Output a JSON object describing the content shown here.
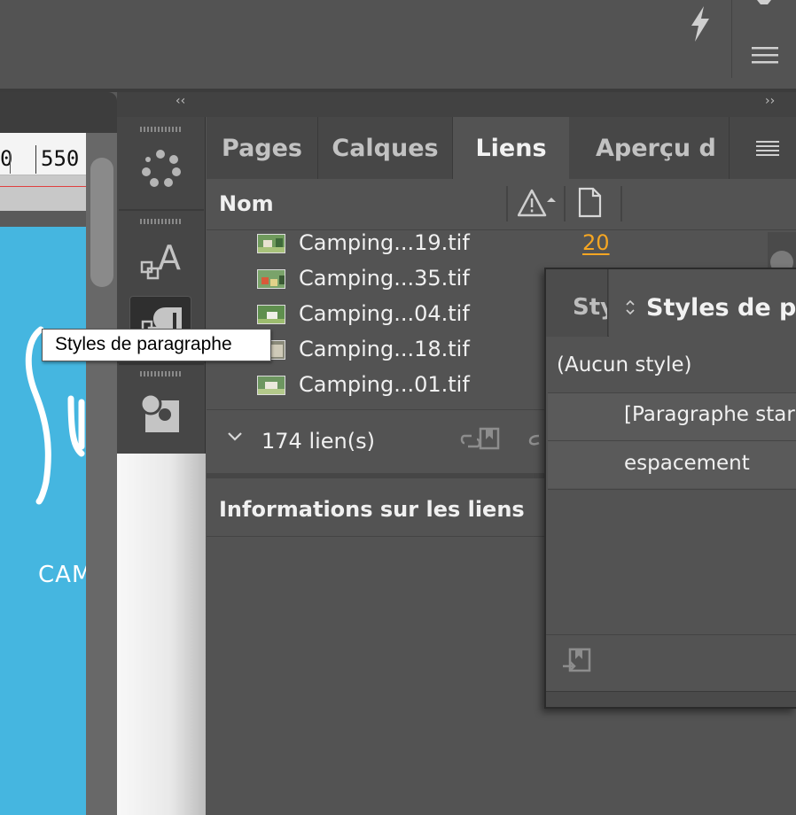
{
  "toolbar": {
    "lightning_icon": "lightning-icon",
    "menu_icon": "hamburger-menu-icon"
  },
  "document": {
    "ruler_left_label": "0",
    "ruler_label": "550",
    "page_text": "CAM"
  },
  "dock": {
    "collapse_left": "‹‹",
    "collapse_right": "››",
    "icons": [
      "color-swatches-icon",
      "character-styles-icon",
      "paragraph-styles-icon",
      "object-styles-icon"
    ]
  },
  "tooltip": {
    "text": "Styles de paragraphe"
  },
  "links_panel": {
    "tabs": [
      {
        "label": "Pages",
        "active": false
      },
      {
        "label": "Calques",
        "active": false
      },
      {
        "label": "Liens",
        "active": true
      },
      {
        "label": "Aperçu d",
        "active": false
      }
    ],
    "column_name": "Nom",
    "links": [
      {
        "name": "Camping...19.tif",
        "page": "20"
      },
      {
        "name": "Camping...35.tif",
        "page": ""
      },
      {
        "name": "Camping...04.tif",
        "page": ""
      },
      {
        "name": "Camping...18.tif",
        "page": ""
      },
      {
        "name": "Camping...01.tif",
        "page": ""
      }
    ],
    "count_label": "174 lien(s)",
    "info_title": "Informations sur les liens"
  },
  "paragraph_styles_panel": {
    "tab_inactive": "Sty",
    "tab_active": "Styles de pa",
    "none_style": "(Aucun style)",
    "styles": [
      {
        "name": "[Paragraphe star",
        "selected": true
      },
      {
        "name": "espacement",
        "selected": true
      }
    ]
  },
  "colors": {
    "accent_orange": "#f5a623",
    "page_blue": "#45b6e0",
    "panel_bg": "#535353"
  }
}
